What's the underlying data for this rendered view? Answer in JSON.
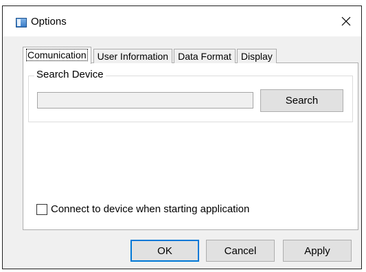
{
  "window": {
    "title": "Options",
    "icon": "app-window-icon",
    "close_icon": "close-icon"
  },
  "tabs": [
    {
      "label": "Comunication",
      "active": true
    },
    {
      "label": "User Information",
      "active": false
    },
    {
      "label": "Data Format",
      "active": false
    },
    {
      "label": "Display",
      "active": false
    }
  ],
  "search_group": {
    "legend": "Search Device",
    "input_value": "",
    "search_button_label": "Search"
  },
  "connect_option": {
    "label": "Connect to device when starting application",
    "checked": false
  },
  "buttons": {
    "ok": "OK",
    "cancel": "Cancel",
    "apply": "Apply"
  },
  "colors": {
    "default_button_border": "#0078d7",
    "dialog_background": "#f0f0f0"
  }
}
